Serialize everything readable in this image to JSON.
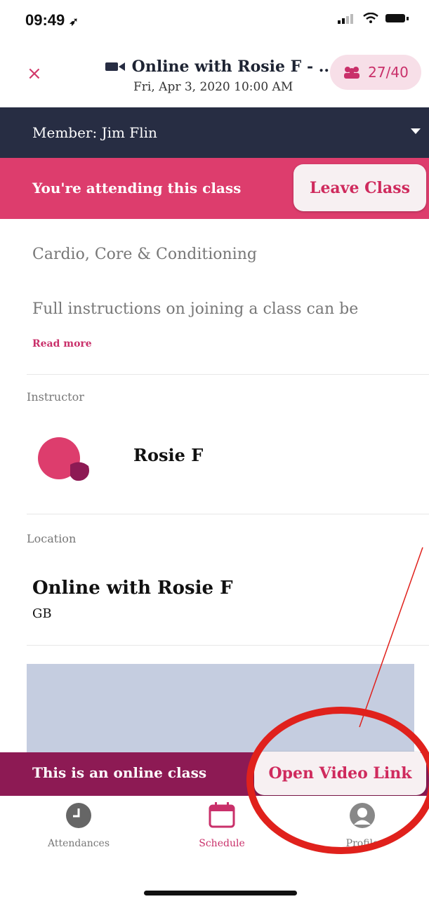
{
  "status": {
    "time": "09:49"
  },
  "header": {
    "close_label": "×",
    "title": "Online with Rosie F - ...",
    "subtitle": "Fri, Apr 3, 2020 10:00 AM",
    "attendance_count": "27/40"
  },
  "member": {
    "label": "Member: Jim Flin"
  },
  "attending": {
    "text": "You're attending this class",
    "leave_label": "Leave Class"
  },
  "description": {
    "line1": "Cardio, Core & Conditioning",
    "line2": "Full instructions on joining a class can be",
    "read_more": "Read more"
  },
  "instructor": {
    "section_label": "Instructor",
    "name": "Rosie F"
  },
  "location": {
    "section_label": "Location",
    "name": "Online with Rosie F",
    "country": "GB"
  },
  "online": {
    "text": "This is an online class",
    "button_label": "Open Video Link"
  },
  "tabs": [
    {
      "label": "Attendances",
      "icon": "clock-icon"
    },
    {
      "label": "Schedule",
      "icon": "calendar-icon"
    },
    {
      "label": "Profile",
      "icon": "profile-icon"
    }
  ],
  "colors": {
    "accent": "#dd3d6d",
    "dark_bar": "#272d43",
    "online_bar": "#8d1a54",
    "annotation_red": "#e0211c"
  }
}
